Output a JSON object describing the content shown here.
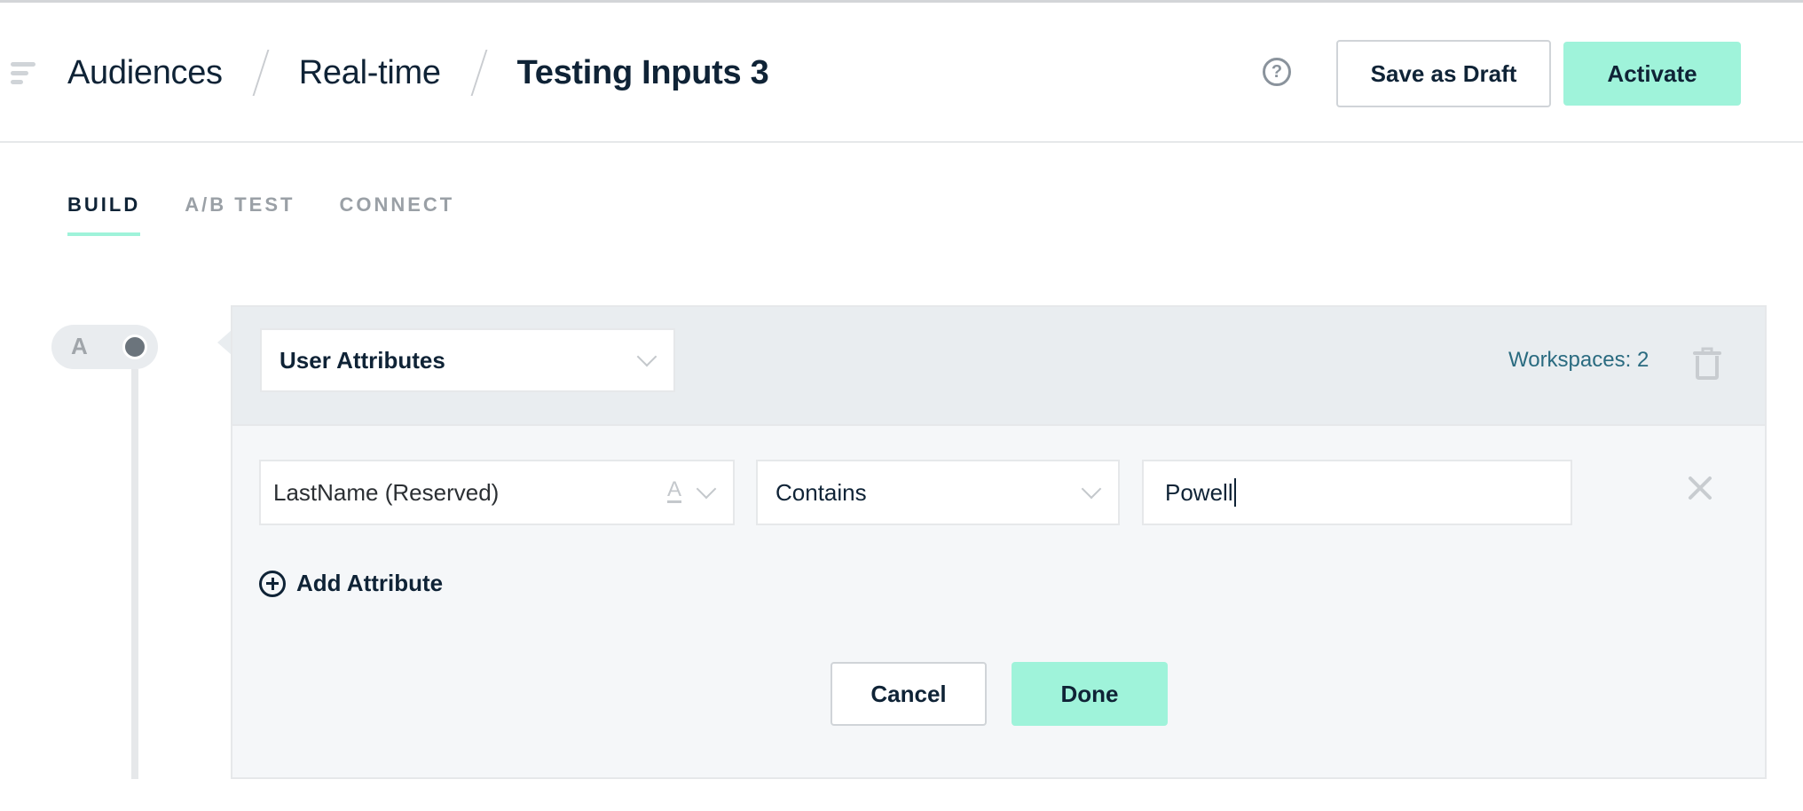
{
  "header": {
    "menu_icon": "menu-icon",
    "breadcrumb": [
      "Audiences",
      "Real-time",
      "Testing Inputs 3"
    ],
    "help_icon": "question-circle-icon",
    "help_glyph": "?",
    "save_draft_label": "Save as Draft",
    "activate_label": "Activate"
  },
  "tabs": [
    {
      "label": "BUILD",
      "active": true
    },
    {
      "label": "A/B TEST",
      "active": false
    },
    {
      "label": "CONNECT",
      "active": false
    }
  ],
  "timeline": {
    "group_letter": "A"
  },
  "panel": {
    "source_select": "User Attributes",
    "workspaces_label": "Workspaces: 2",
    "condition": {
      "attribute": "LastName (Reserved)",
      "attribute_type_glyph": "A",
      "operator": "Contains",
      "value": "Powell"
    },
    "add_attribute_label": "Add Attribute",
    "cancel_label": "Cancel",
    "done_label": "Done"
  },
  "colors": {
    "accent": "#9ff3da",
    "text_dark": "#0f2336",
    "workspace_link": "#2a6b80",
    "muted": "#9aa0a6"
  }
}
